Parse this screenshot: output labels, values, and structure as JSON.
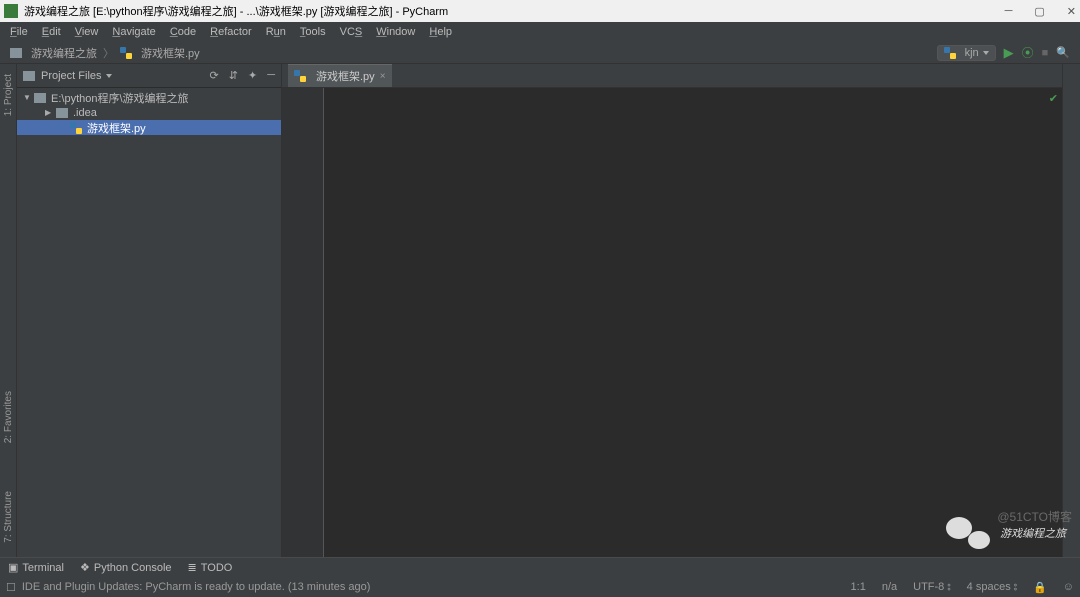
{
  "titlebar": {
    "title": "游戏编程之旅 [E:\\python程序\\游戏编程之旅] - ...\\游戏框架.py [游戏编程之旅] - PyCharm"
  },
  "menu": {
    "file": "File",
    "edit": "Edit",
    "view": "View",
    "navigate": "Navigate",
    "code": "Code",
    "refactor": "Refactor",
    "run": "Run",
    "tools": "Tools",
    "vcs": "VCS",
    "window": "Window",
    "help": "Help"
  },
  "breadcrumb": {
    "root": "游戏编程之旅",
    "file": "游戏框架.py"
  },
  "runConfig": {
    "name": "kjn"
  },
  "projectPanel": {
    "title": "Project Files",
    "tree": [
      {
        "label": "E:\\python程序\\游戏编程之旅",
        "lvl": "l1",
        "exp": "▼",
        "icon": "folder",
        "sel": false
      },
      {
        "label": ".idea",
        "lvl": "l2",
        "exp": "▶",
        "icon": "folder",
        "sel": false
      },
      {
        "label": "游戏框架.py",
        "lvl": "l3",
        "exp": "",
        "icon": "py",
        "sel": true
      }
    ]
  },
  "editor": {
    "tab": "游戏框架.py"
  },
  "bottomTools": {
    "terminal": "Terminal",
    "python": "Python Console",
    "todo": "TODO"
  },
  "leftGutter": {
    "project": "1: Project",
    "favorites": "2: Favorites",
    "structure": "7: Structure"
  },
  "status": {
    "msg": "IDE and Plugin Updates: PyCharm is ready to update. (13 minutes ago)",
    "pos": "1:1",
    "enc": "n/a",
    "utf": "UTF-8",
    "indent": "4 spaces"
  },
  "watermark": "游戏编程之旅",
  "blogMark": "@51CTO博客"
}
